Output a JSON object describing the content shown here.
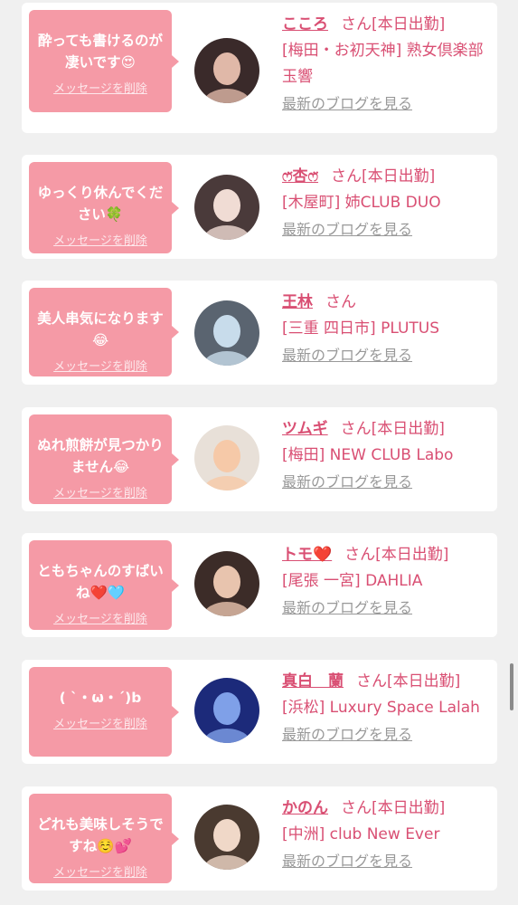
{
  "cards": [
    {
      "message": "酔っても書けるのが凄いです😍",
      "delete_label": "メッセージを削除",
      "name": "こころ",
      "san": "さん",
      "today": "[本日出勤]",
      "location": "[梅田・お初天神] 熟女倶楽部 玉響",
      "blog_label": "最新のブログを見る",
      "avatar_colors": [
        "#3a2a2a",
        "#e0b8a8"
      ]
    },
    {
      "message": "ゆっくり休んでください🍀",
      "delete_label": "メッセージを削除",
      "name": "ෆ̈杏ෆ̈",
      "san": "さん",
      "today": "[本日出勤]",
      "location": "[木屋町] 姉CLUB DUO",
      "blog_label": "最新のブログを見る",
      "avatar_colors": [
        "#4a3a3a",
        "#f0dcd4"
      ]
    },
    {
      "message": "美人串気になります😂",
      "delete_label": "メッセージを削除",
      "name": "王林",
      "san": "さん",
      "today": "",
      "location": "[三重 四日市] PLUTUS",
      "blog_label": "最新のブログを見る",
      "avatar_colors": [
        "#5a6470",
        "#c8dceb"
      ]
    },
    {
      "message": "ぬれ煎餅が見つかりません😂",
      "delete_label": "メッセージを削除",
      "name": "ツムギ",
      "san": "さん",
      "today": "[本日出勤]",
      "location": "[梅田] NEW CLUB Labo",
      "blog_label": "最新のブログを見る",
      "avatar_colors": [
        "#e8e0d8",
        "#f6c9a8"
      ]
    },
    {
      "message": "ともちゃんのすばいね❤️🩵",
      "delete_label": "メッセージを削除",
      "name": "トモ❤️",
      "san": "さん",
      "today": "[本日出勤]",
      "location": "[尾張 一宮] DAHLIA",
      "blog_label": "最新のブログを見る",
      "avatar_colors": [
        "#3c2c28",
        "#e8c4ae"
      ]
    },
    {
      "message": "( ˋ・ω・ˊ)b",
      "delete_label": "メッセージを削除",
      "name": "真白　蘭",
      "san": "さん",
      "today": "[本日出勤]",
      "location": "[浜松] Luxury Space Lalah",
      "blog_label": "最新のブログを見る",
      "avatar_colors": [
        "#1c2a7a",
        "#7fa0e8"
      ]
    },
    {
      "message": "どれも美味しそうですね☺️💕",
      "delete_label": "メッセージを削除",
      "name": "かのん",
      "san": "さん",
      "today": "[本日出勤]",
      "location": "[中洲] club New Ever",
      "blog_label": "最新のブログを見る",
      "avatar_colors": [
        "#4a3a30",
        "#f0d8c8"
      ]
    }
  ]
}
